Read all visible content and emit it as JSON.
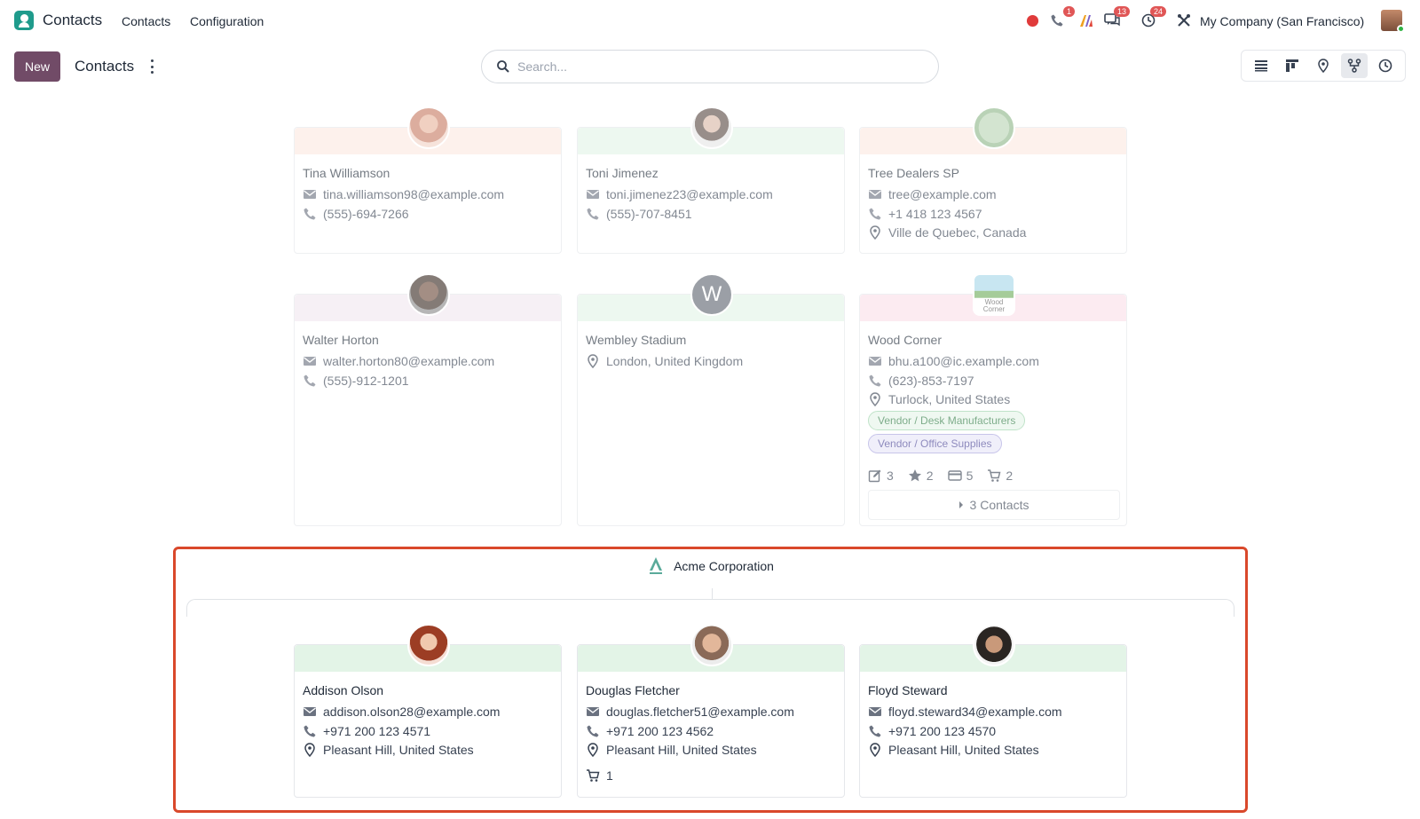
{
  "app": {
    "title": "Contacts"
  },
  "menu": [
    {
      "label": "Contacts"
    },
    {
      "label": "Configuration"
    }
  ],
  "systray": {
    "calls_badge": "1",
    "messages_badge": "13",
    "activities_badge": "24",
    "company": "My Company (San Francisco)"
  },
  "control": {
    "new_label": "New",
    "breadcrumb": "Contacts",
    "search_placeholder": "Search..."
  },
  "views": [
    "list-view-icon",
    "kanban-view-icon",
    "map-view-icon",
    "hierarchy-view-icon",
    "activity-view-icon"
  ],
  "colors": {
    "primary": "#714b67",
    "highlight": "#d9482b",
    "green_band": "#e3f4e7",
    "peach_band": "#fde9e2",
    "pink_band": "#fbe0ea",
    "lavender_band": "#f1e7f0"
  },
  "cards": [
    {
      "name": "Tina Williamson",
      "email": "tina.williamson98@example.com",
      "phone": "(555)-694-7266"
    },
    {
      "name": "Toni Jimenez",
      "email": "toni.jimenez23@example.com",
      "phone": "(555)-707-8451"
    },
    {
      "name": "Tree Dealers SP",
      "email": "tree@example.com",
      "phone": "+1 418 123 4567",
      "address": "Ville de Quebec, Canada"
    },
    {
      "name": "Walter Horton",
      "email": "walter.horton80@example.com",
      "phone": "(555)-912-1201"
    },
    {
      "name": "Wembley Stadium",
      "avatar_letter": "W",
      "address": "London, United Kingdom"
    },
    {
      "name": "Wood Corner",
      "avatar_text": "Wood Corner",
      "email": "bhu.a100@ic.example.com",
      "phone": "(623)-853-7197",
      "address": "Turlock, United States",
      "tags": [
        "Vendor / Desk Manufacturers",
        "Vendor / Office Supplies"
      ],
      "stats": {
        "tasks": "3",
        "stars": "2",
        "cards": "5",
        "orders": "2"
      },
      "contacts_button": "3 Contacts"
    }
  ],
  "parent": {
    "name": "Acme Corporation",
    "children": [
      {
        "name": "Addison Olson",
        "email": "addison.olson28@example.com",
        "phone": "+971 200 123 4571",
        "address": "Pleasant Hill, United States"
      },
      {
        "name": "Douglas Fletcher",
        "email": "douglas.fletcher51@example.com",
        "phone": "+971 200 123 4562",
        "address": "Pleasant Hill, United States",
        "orders": "1"
      },
      {
        "name": "Floyd Steward",
        "email": "floyd.steward34@example.com",
        "phone": "+971 200 123 4570",
        "address": "Pleasant Hill, United States"
      }
    ]
  }
}
